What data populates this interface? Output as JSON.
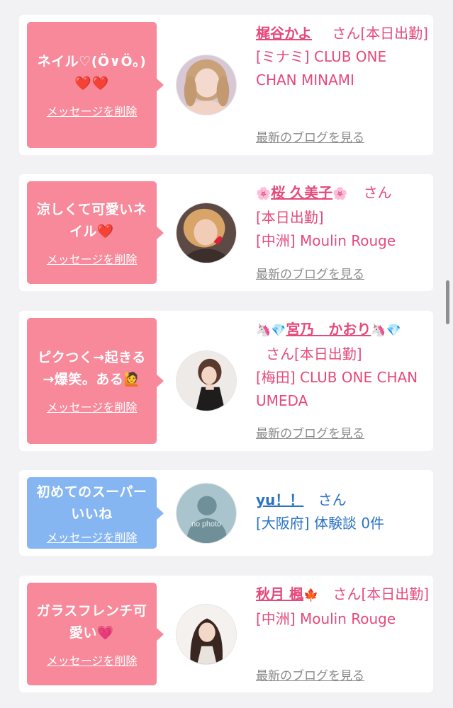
{
  "common": {
    "delete_label": "メッセージを削除",
    "blog_label": "最新のブログを見る",
    "san_label": "さん"
  },
  "colors": {
    "pink_bubble": "#f7899b",
    "blue_bubble": "#86b6f2",
    "pink_text": "#e6497a",
    "blue_text": "#2a72c4"
  },
  "items": [
    {
      "message": "ネイル♡(Ö∨Ö。)❤️❤️",
      "name": "梶谷かよ",
      "status": "[本日出勤]",
      "shop": "[ミナミ] CLUB ONE CHAN MINAMI",
      "avatar_icon": "woman-blonde-photo"
    },
    {
      "message": "涼しくて可愛いネイル❤️",
      "name_prefix": "🌸",
      "name": "桜 久美子",
      "name_suffix": "🌸",
      "status": "[本日出勤]",
      "shop": "[中洲] Moulin Rouge",
      "avatar_icon": "woman-heart-photo"
    },
    {
      "message": "ピクつく→起きる→爆笑。ある🙋",
      "name_prefix": "🦄💎",
      "name": "宮乃　かおり",
      "name_suffix": "🦄💎",
      "status": "[本日出勤]",
      "shop": "[梅田] CLUB ONE CHAN UMEDA",
      "avatar_icon": "woman-side-photo"
    },
    {
      "message": "初めてのスーパーいいね",
      "name": "yu！！",
      "status": "",
      "shop": "[大阪府] 体験談 0件",
      "avatar_icon": "no-photo-silhouette",
      "avatar_text": "no photo"
    },
    {
      "message": "ガラスフレンチ可愛い💗",
      "name": "秋月 楓",
      "name_suffix": "🍁",
      "status": "[本日出勤]",
      "shop": "[中洲] Moulin Rouge",
      "avatar_icon": "woman-longhair-photo"
    }
  ]
}
